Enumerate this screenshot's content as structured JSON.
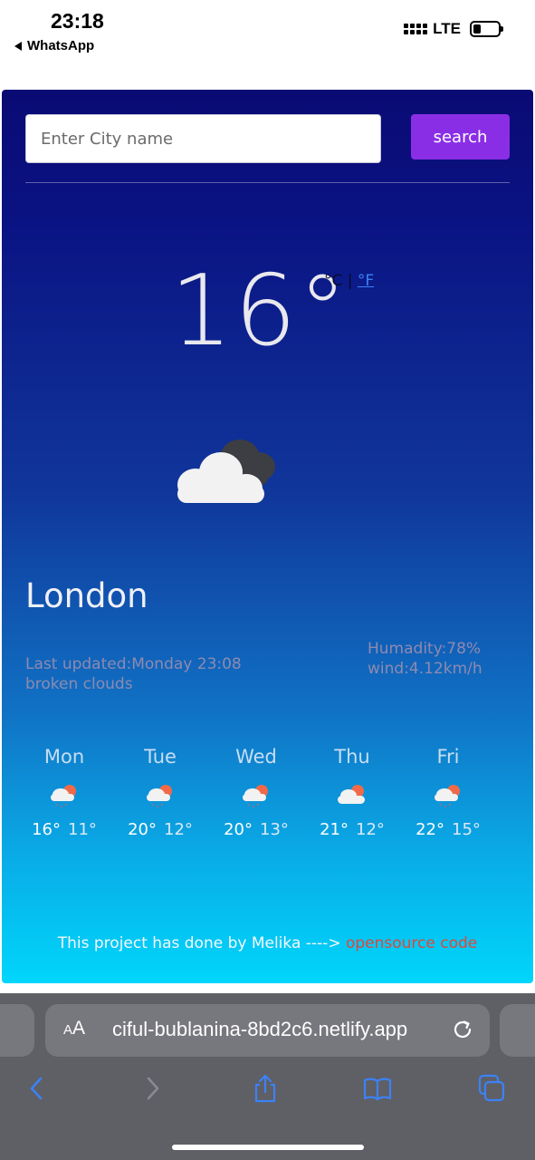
{
  "status_bar": {
    "time": "23:18",
    "back_app": "WhatsApp",
    "network": "LTE",
    "battery_level": 0.3
  },
  "search": {
    "placeholder": "Enter City name",
    "button_label": "search"
  },
  "current": {
    "temperature": "16°",
    "unit_celsius": "°C | ",
    "unit_fahrenheit": "°F",
    "icon": "broken-clouds-icon",
    "city": "London",
    "last_updated": "Last updated:Monday 23:08",
    "description": "broken clouds",
    "humidity": "Humadity:78%",
    "wind": "wind:4.12km/h"
  },
  "forecast": [
    {
      "day": "Mon",
      "icon": "rain-sun-icon",
      "max": "16°",
      "min": "11°"
    },
    {
      "day": "Tue",
      "icon": "rain-sun-icon",
      "max": "20°",
      "min": "12°"
    },
    {
      "day": "Wed",
      "icon": "rain-sun-icon",
      "max": "20°",
      "min": "13°"
    },
    {
      "day": "Thu",
      "icon": "cloud-sun-icon",
      "max": "21°",
      "min": "12°"
    },
    {
      "day": "Fri",
      "icon": "rain-sun-icon",
      "max": "22°",
      "min": "15°"
    }
  ],
  "footer": {
    "text": "This project has done by Melika ----> ",
    "link_text": "opensource code"
  },
  "browser": {
    "aa_label_small": "A",
    "aa_label_big": "A",
    "url": "ciful-bublanina-8bd2c6.netlify.app"
  },
  "colors": {
    "accent": "#8a2ee6",
    "link": "#e0473a",
    "ios_blue": "#3b82f6"
  }
}
